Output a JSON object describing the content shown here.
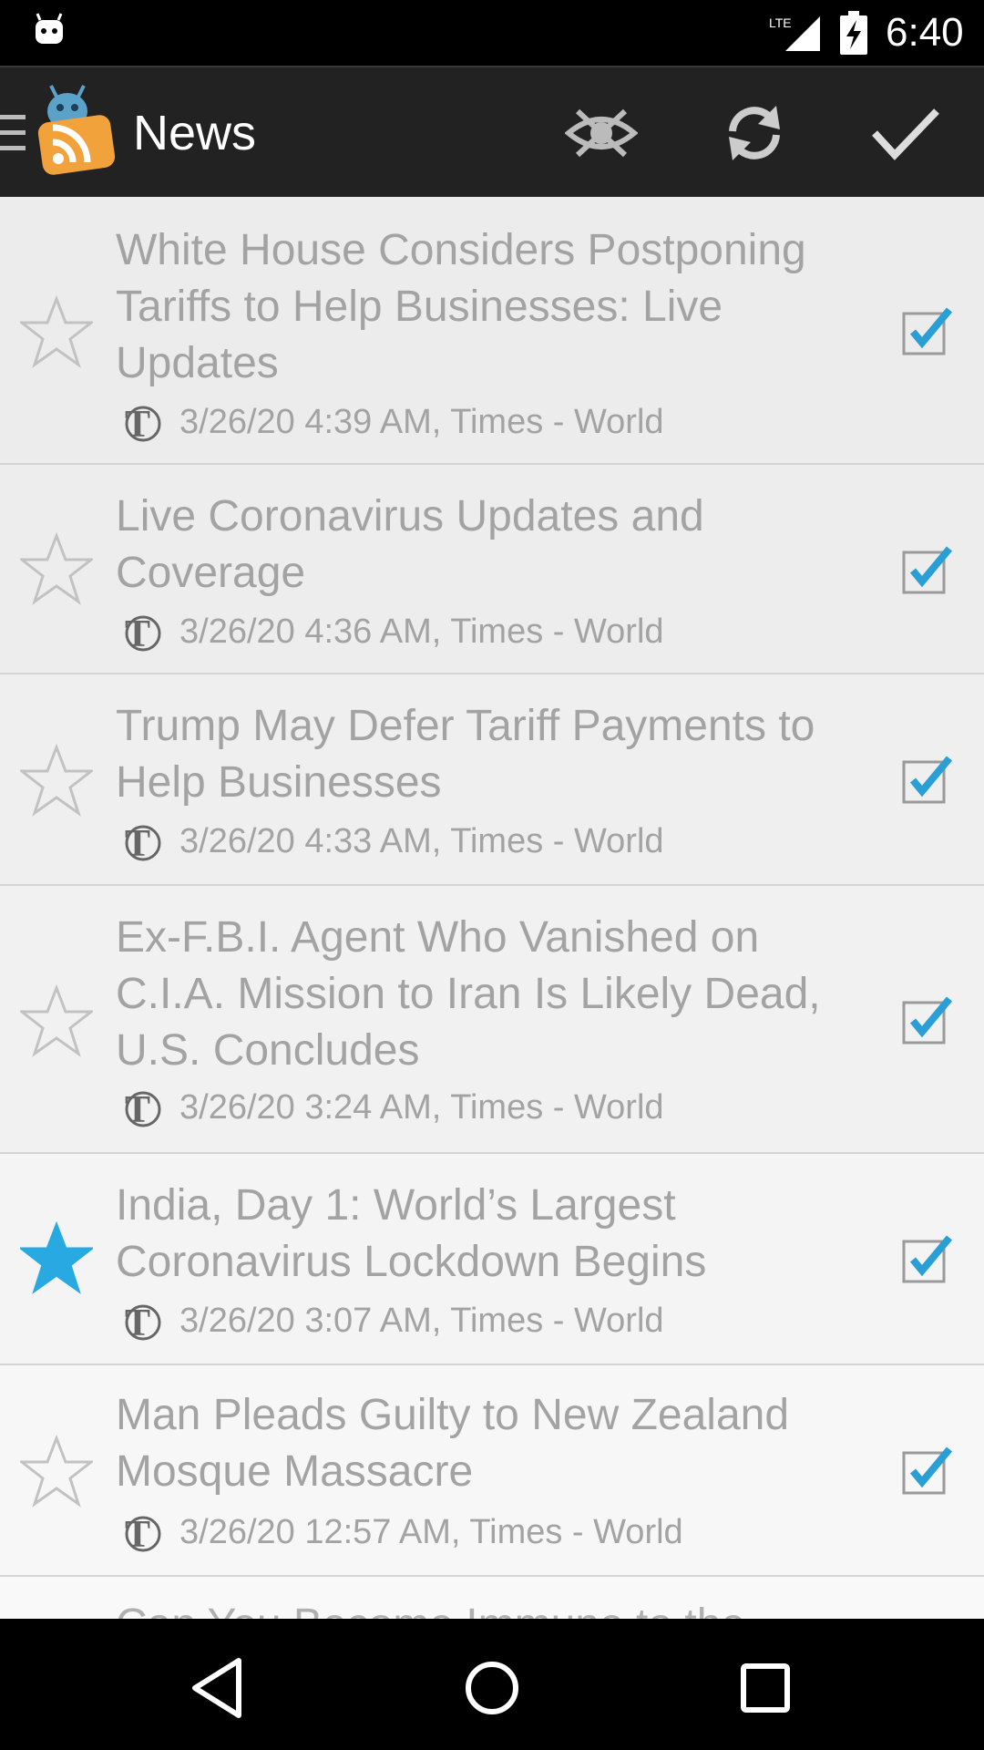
{
  "status_bar": {
    "network": "LTE",
    "time": "6:40"
  },
  "action_bar": {
    "title": "News",
    "actions": [
      {
        "name": "hide-read",
        "icon": "eye-crossed-icon"
      },
      {
        "name": "refresh",
        "icon": "refresh-icon"
      },
      {
        "name": "mark-all-read",
        "icon": "checkmark-icon"
      }
    ]
  },
  "articles": [
    {
      "headline": "White House Considers Postponing Tariffs to Help Businesses: Live Updates",
      "meta": "3/26/20 4:39 AM, Times - World",
      "starred": false,
      "read": true
    },
    {
      "headline": "Live Coronavirus Updates and Coverage",
      "meta": "3/26/20 4:36 AM, Times - World",
      "starred": false,
      "read": true
    },
    {
      "headline": "Trump May Defer Tariff Payments to Help Businesses",
      "meta": "3/26/20 4:33 AM, Times - World",
      "starred": false,
      "read": true
    },
    {
      "headline": "Ex-F.B.I. Agent Who Vanished on C.I.A. Mission to Iran Is Likely Dead, U.S. Concludes",
      "meta": "3/26/20 3:24 AM, Times - World",
      "starred": false,
      "read": true
    },
    {
      "headline": "India, Day 1: World’s Largest Coronavirus Lockdown Begins",
      "meta": "3/26/20 3:07 AM, Times - World",
      "starred": true,
      "read": true
    },
    {
      "headline": "Man Pleads Guilty to New Zealand Mosque Massacre",
      "meta": "3/26/20 12:57 AM, Times - World",
      "starred": false,
      "read": true
    }
  ],
  "partial_article": {
    "headline": "Can You Become Immune to the"
  },
  "colors": {
    "star_active": "#29a9e1",
    "check": "#2a9fd6",
    "action_bar": "#222222"
  },
  "nav_bar": {
    "buttons": [
      "back-icon",
      "home-icon",
      "recents-icon"
    ]
  }
}
